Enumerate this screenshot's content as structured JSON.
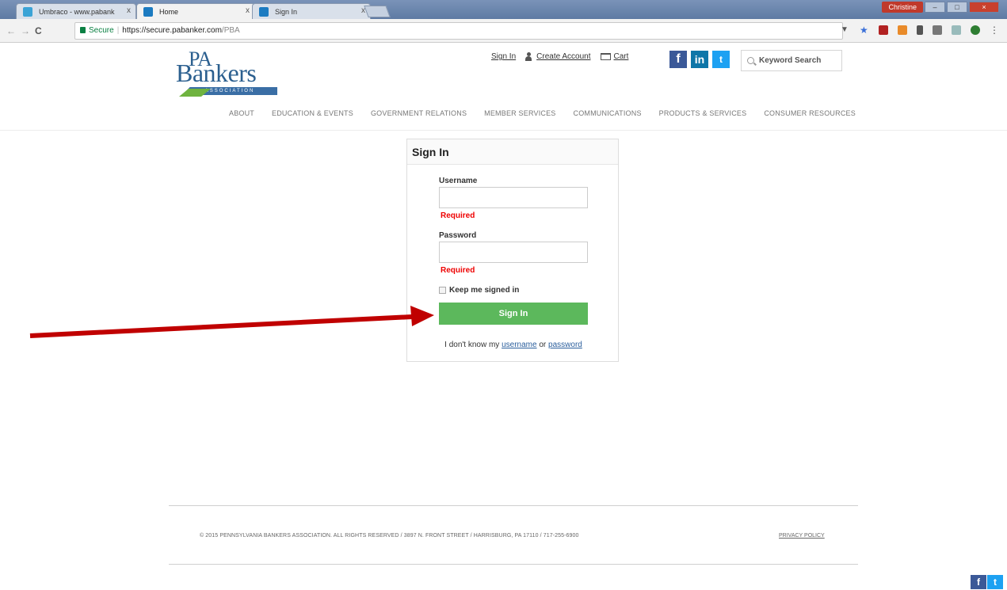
{
  "browser": {
    "tabs": [
      {
        "title": "Umbraco - www.pabank",
        "favicon_color": "#3aa3d6"
      },
      {
        "title": "Home",
        "favicon_color": "#1c7bc1"
      },
      {
        "title": "Sign In",
        "favicon_color": "#1c7bc1"
      }
    ],
    "close_glyph": "x",
    "user_badge": "Christine",
    "url_secure_label": "Secure",
    "url_host": "https://secure.pabanker.com",
    "url_path": "/PBA",
    "nav": {
      "back": "←",
      "forward": "→",
      "reload": "C"
    }
  },
  "header": {
    "logo": {
      "pa": "PA",
      "bankers": "Bankers",
      "tagline": "ASSOCIATION"
    },
    "links": {
      "sign_in": "Sign In",
      "create_account": "Create Account",
      "cart": "Cart"
    },
    "social": {
      "facebook": "f",
      "linkedin": "in",
      "twitter": "t"
    },
    "search_placeholder": "Keyword Search",
    "nav_items": [
      "ABOUT",
      "EDUCATION & EVENTS",
      "GOVERNMENT RELATIONS",
      "MEMBER SERVICES",
      "COMMUNICATIONS",
      "PRODUCTS & SERVICES",
      "CONSUMER RESOURCES"
    ]
  },
  "signin": {
    "title": "Sign In",
    "username_label": "Username",
    "username_value": "",
    "username_error": "Required",
    "password_label": "Password",
    "password_value": "",
    "password_error": "Required",
    "keep_signed_in": "Keep me signed in",
    "keep_signed_in_checked": false,
    "button": "Sign In",
    "forgot_prefix": "I don't know my",
    "forgot_username": "username",
    "forgot_or": "or",
    "forgot_password": "password"
  },
  "footer": {
    "copyright": "© 2015 PENNSYLVANIA BANKERS ASSOCIATION. ALL RIGHTS RESERVED / 3897 N. FRONT STREET / HARRISBURG, PA 17110 / 717-255-6900",
    "privacy": "PRIVACY POLICY",
    "social": {
      "facebook": "f",
      "twitter": "t"
    }
  },
  "colors": {
    "annotation_arrow": "#c00000",
    "signin_button": "#5cb85c",
    "brand_blue": "#2b5f8f"
  }
}
